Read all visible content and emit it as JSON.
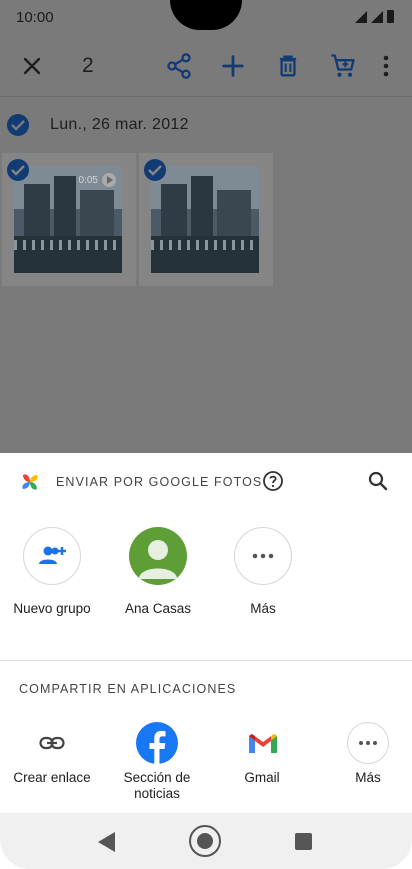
{
  "status_bar": {
    "time": "10:00"
  },
  "toolbar": {
    "selected_count": "2"
  },
  "gallery": {
    "date": "Lun., 26 mar. 2012",
    "video_duration": "0:05"
  },
  "share_sheet": {
    "send_title": "ENVIAR POR GOOGLE FOTOS",
    "contacts": [
      {
        "label": "Nuevo grupo"
      },
      {
        "label": "Ana Casas"
      },
      {
        "label": "Más"
      }
    ],
    "apps_title": "COMPARTIR EN APLICACIONES",
    "apps": [
      {
        "label": "Crear enlace"
      },
      {
        "label": "Sección de noticias"
      },
      {
        "label": "Gmail"
      },
      {
        "label": "Más"
      }
    ]
  },
  "colors": {
    "scrim": "#7a7a7a",
    "toolbar_icon": "#123b73",
    "avatar_green": "#5e9e37",
    "facebook_blue": "#1877f2"
  }
}
